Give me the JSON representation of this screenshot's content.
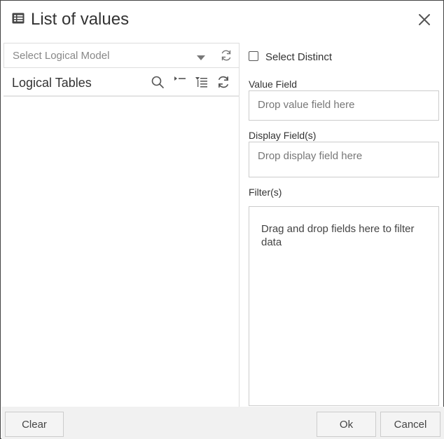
{
  "dialog": {
    "title": "List of values",
    "title_icon": "list-table-icon",
    "close_icon": "close-icon"
  },
  "left_panel": {
    "model_select": {
      "placeholder": "Select Logical Model",
      "caret_icon": "caret-down-icon",
      "refresh_icon": "refresh-icon"
    },
    "tables": {
      "label": "Logical Tables",
      "toolbar_icons": [
        "search-icon",
        "collapse-all-icon",
        "expand-all-icon",
        "refresh-icon"
      ]
    }
  },
  "right_panel": {
    "select_distinct": {
      "label": "Select Distinct",
      "checked": false
    },
    "value_field": {
      "label": "Value Field",
      "placeholder": "Drop value field here"
    },
    "display_field": {
      "label": "Display Field(s)",
      "placeholder": "Drop display field here"
    },
    "filters": {
      "label": "Filter(s)",
      "placeholder": "Drag and drop fields here to filter data"
    }
  },
  "footer": {
    "clear_label": "Clear",
    "ok_label": "Ok",
    "cancel_label": "Cancel"
  }
}
